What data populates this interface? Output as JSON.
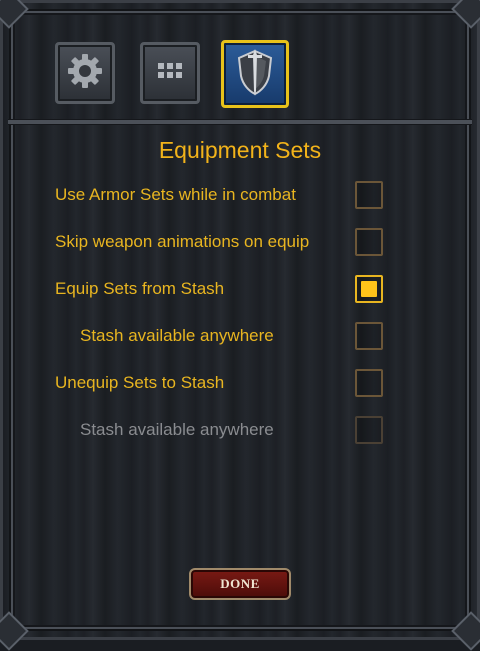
{
  "tabs": [
    {
      "icon": "gear-icon",
      "active": false
    },
    {
      "icon": "grid-icon",
      "active": false
    },
    {
      "icon": "shield-sword-icon",
      "active": true
    }
  ],
  "page": {
    "title": "Equipment Sets"
  },
  "options": [
    {
      "label": "Use Armor Sets while in combat",
      "checked": false,
      "indent": false,
      "disabled": false
    },
    {
      "label": "Skip weapon animations on equip",
      "checked": false,
      "indent": false,
      "disabled": false
    },
    {
      "label": "Equip Sets from Stash",
      "checked": true,
      "indent": false,
      "disabled": false
    },
    {
      "label": "Stash available anywhere",
      "checked": false,
      "indent": true,
      "disabled": false
    },
    {
      "label": "Unequip Sets to Stash",
      "checked": false,
      "indent": false,
      "disabled": false
    },
    {
      "label": "Stash available anywhere",
      "checked": false,
      "indent": true,
      "disabled": true
    }
  ],
  "footer": {
    "done_label": "DONE"
  },
  "colors": {
    "accent": "#f2b31a",
    "active_tab_border": "#e8c21a",
    "active_tab_fill": "#2c5c99",
    "done_fill": "#7a1a14"
  }
}
